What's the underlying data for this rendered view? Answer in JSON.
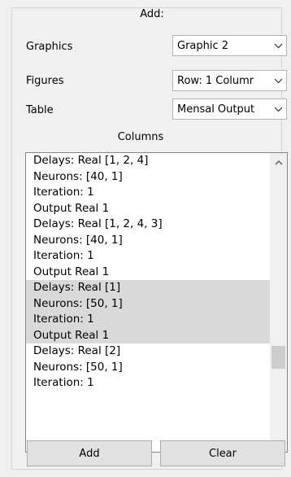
{
  "group": {
    "title": "Add:"
  },
  "options": [
    {
      "label": "Graphics",
      "value": "Graphic 2"
    },
    {
      "label": "Figures",
      "value": "Row: 1 Columr"
    },
    {
      "label": "Table",
      "value": "Mensal Output"
    }
  ],
  "columns": {
    "label": "Columns",
    "items": [
      {
        "lines": [
          "Delays: Real [1, 2, 4]",
          "Neurons: [40, 1]",
          "Iteration: 1",
          "Output Real 1"
        ],
        "selected": false
      },
      {
        "lines": [
          "Delays: Real [1, 2, 4, 3]",
          "Neurons: [40, 1]",
          "Iteration: 1",
          "Output Real 1"
        ],
        "selected": false
      },
      {
        "lines": [
          "Delays: Real [1]",
          "Neurons: [50, 1]",
          "Iteration: 1",
          "Output Real 1"
        ],
        "selected": true
      },
      {
        "lines": [
          "Delays: Real [2]",
          "Neurons: [50, 1]",
          "Iteration: 1"
        ],
        "selected": false
      }
    ]
  },
  "buttons": {
    "add_label": "Add",
    "clear_label": "Clear"
  },
  "icons": {
    "combo_arrow": "chevron-down-icon",
    "scroll_up": "chevron-up-icon",
    "scroll_down": "chevron-down-icon"
  },
  "colors": {
    "selection": "#d9d9d9",
    "scroll_thumb": "#cdcdcd",
    "button_face": "#e1e1e1"
  }
}
